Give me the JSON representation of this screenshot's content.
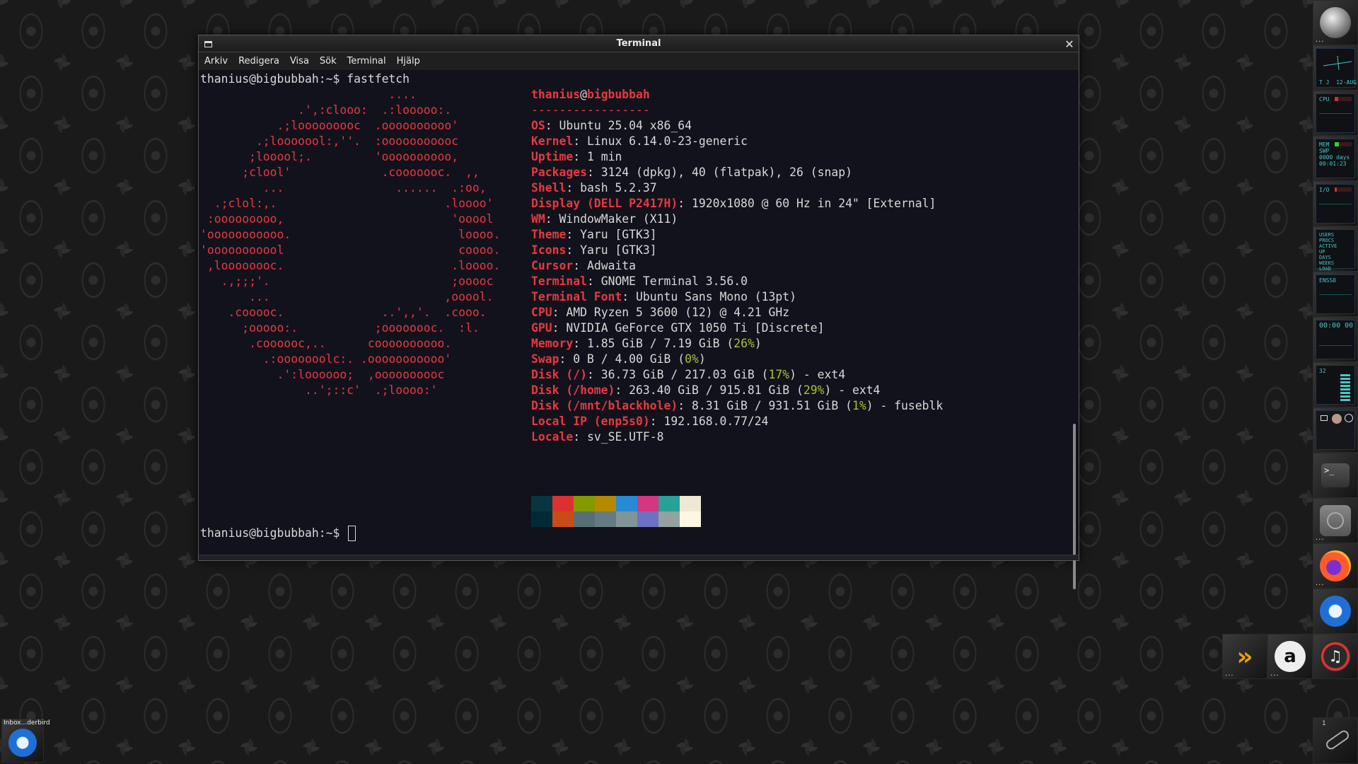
{
  "window": {
    "title": "Terminal",
    "menu": [
      "Arkiv",
      "Redigera",
      "Visa",
      "Sök",
      "Terminal",
      "Hjälp"
    ]
  },
  "terminal": {
    "prompt1": "thanius@bigbubbah:~$ fastfetch",
    "prompt2": "thanius@bigbubbah:~$ ",
    "logo": [
      "                           ....",
      "              .',:clooo:  .:looooo:.",
      "           .;looooooooc  .oooooooooo'",
      "        .;looooool:,''.  :ooooooooooc",
      "       ;looool;.         'oooooooooo,",
      "      ;clool'             .cooooooc.  ,,",
      "         ...                ......  .:oo,",
      "  .;clol:,.                        .loooo'",
      " :ooooooooo,                        'ooool",
      "'ooooooooooo.                        loooo.",
      "'ooooooooool                         coooo.",
      " ,loooooooc.                        .loooo.",
      "   .,;;;'.                          ;ooooc",
      "       ...                         ,ooool.",
      "    .cooooc.              ..',,'.  .cooo.",
      "      ;ooooo:.           ;oooooooc.  :l.",
      "       .coooooc,..      coooooooooo.",
      "         .:ooooooolc:. .ooooooooooo'",
      "           .':loooooo;  ,oooooooooc",
      "               ..';::c'  .;loooo:'"
    ],
    "user": "thanius",
    "at": "@",
    "host": "bigbubbah",
    "separator": "-----------------",
    "info": [
      {
        "key": "OS",
        "value": "Ubuntu 25.04 x86_64"
      },
      {
        "key": "Kernel",
        "value": "Linux 6.14.0-23-generic"
      },
      {
        "key": "Uptime",
        "value": "1 min"
      },
      {
        "key": "Packages",
        "value": "3124 (dpkg), 40 (flatpak), 26 (snap)"
      },
      {
        "key": "Shell",
        "value": "bash 5.2.37"
      },
      {
        "key": "Display (DELL P2417H)",
        "value": "1920x1080 @ 60 Hz in 24\" [External]"
      },
      {
        "key": "WM",
        "value": "WindowMaker (X11)"
      },
      {
        "key": "Theme",
        "value": "Yaru [GTK3]"
      },
      {
        "key": "Icons",
        "value": "Yaru [GTK3]"
      },
      {
        "key": "Cursor",
        "value": "Adwaita"
      },
      {
        "key": "Terminal",
        "value": "GNOME Terminal 3.56.0"
      },
      {
        "key": "Terminal Font",
        "value": "Ubuntu Sans Mono (13pt)"
      },
      {
        "key": "CPU",
        "value": "AMD Ryzen 5 3600 (12) @ 4.21 GHz"
      },
      {
        "key": "GPU",
        "value": "NVIDIA GeForce GTX 1050 Ti [Discrete]"
      },
      {
        "key": "Memory",
        "pre": "1.85 GiB / 7.19 GiB (",
        "pct": "26%",
        "post": ")"
      },
      {
        "key": "Swap",
        "pre": "0 B / 4.00 GiB (",
        "pct": "0%",
        "post": ")"
      },
      {
        "key": "Disk (/)",
        "pre": "36.73 GiB / 217.03 GiB (",
        "pct": "17%",
        "post": ") - ext4"
      },
      {
        "key": "Disk (/home)",
        "pre": "263.40 GiB / 915.81 GiB (",
        "pct": "29%",
        "post": ") - ext4"
      },
      {
        "key": "Disk (/mnt/blackhole)",
        "pre": "8.31 GiB / 931.51 GiB (",
        "pct": "1%",
        "post": ") - fuseblk"
      },
      {
        "key": "Local IP (enp5s0)",
        "value": "192.168.0.77/24"
      },
      {
        "key": "Locale",
        "value": "sv_SE.UTF-8"
      }
    ],
    "palette_top": [
      "#073642",
      "#dc322f",
      "#859900",
      "#b58900",
      "#268bd2",
      "#d33682",
      "#2aa198",
      "#eee8d5"
    ],
    "palette_bottom": [
      "#002b36",
      "#cb4b16",
      "#586e75",
      "#657b83",
      "#839496",
      "#6c71c4",
      "#93a1a1",
      "#fdf6e3"
    ],
    "colors": {
      "key": "#e8383f",
      "percent": "#a6c23a",
      "text": "#d8d8d8",
      "background": "#12121c"
    }
  },
  "dock": {
    "clock_label": "T J  12-AUG",
    "cpu_label": "CPU",
    "mem_label": "MEM\nSWP\n0000 days\n00:01:23",
    "io_label": "I/O",
    "users_label": "USERS\nPROCS\nACTIVE\nUP\nDAYS\nWEEKS\nLOAD",
    "net_label": "ENSS0",
    "timer_label": "00:00 00",
    "vol_label": "32",
    "terminal_glyph": ">_"
  },
  "desktop": {
    "miniwindow_label": "Inbox...derbird",
    "clip_number": "1"
  }
}
